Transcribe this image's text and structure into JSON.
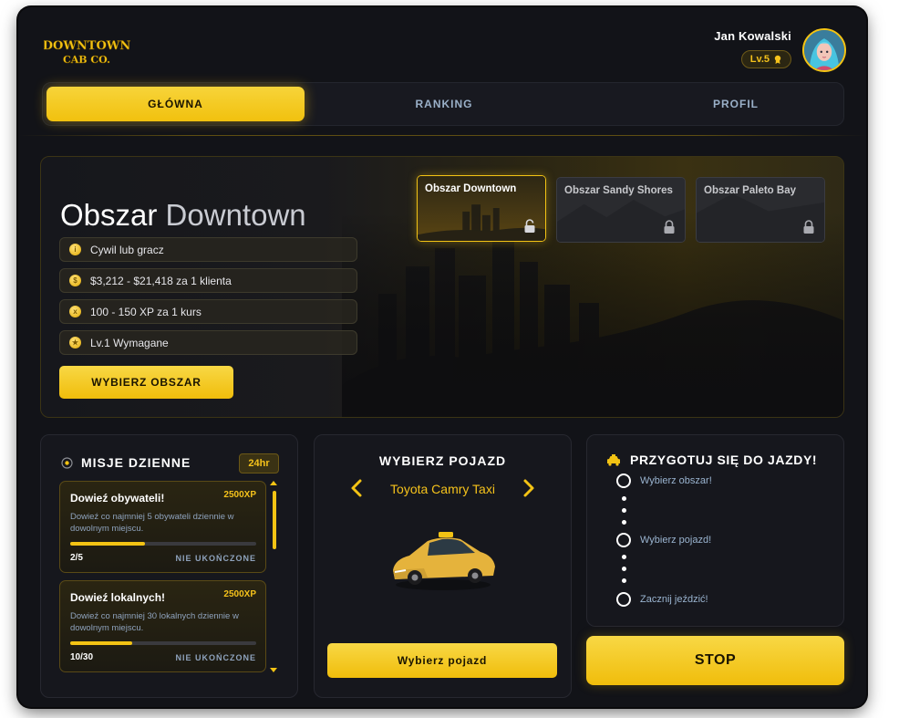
{
  "header": {
    "logo_text_line1": "DOWNTOWN",
    "logo_text_line2": "CAB CO.",
    "user_name": "Jan Kowalski",
    "level": "Lv.5"
  },
  "tabs": [
    {
      "label": "GŁÓWNA",
      "active": true
    },
    {
      "label": "RANKING",
      "active": false
    },
    {
      "label": "PROFIL",
      "active": false
    }
  ],
  "area": {
    "title_prefix": "Obszar",
    "title_name": "Downtown",
    "info": [
      {
        "icon": "info-coin-icon",
        "text": "Cywil lub gracz"
      },
      {
        "icon": "money-coin-icon",
        "text": "$3,212 - $21,418 za 1 klienta"
      },
      {
        "icon": "xp-coin-icon",
        "text": "100 - 150 XP za 1 kurs"
      },
      {
        "icon": "level-coin-icon",
        "text": "Lv.1 Wymagane"
      }
    ],
    "select_button": "WYBIERZ OBSZAR",
    "cards": [
      {
        "label": "Obszar Downtown",
        "active": true
      },
      {
        "label": "Obszar Sandy Shores",
        "active": false
      },
      {
        "label": "Obszar Paleto Bay",
        "active": false
      }
    ]
  },
  "missions": {
    "title": "MISJE DZIENNE",
    "badge": "24hr",
    "items": [
      {
        "title": "Dowieź obywateli!",
        "xp": "2500XP",
        "desc": "Dowieź co najmniej 5 obywateli dziennie w dowolnym miejscu.",
        "progress": "2/5",
        "fraction": 0.4,
        "status": "NIE UKOŃCZONE"
      },
      {
        "title": "Dowieź lokalnych!",
        "xp": "2500XP",
        "desc": "Dowieź co najmniej 30 lokalnych dziennie w dowolnym miejscu.",
        "progress": "10/30",
        "fraction": 0.333,
        "status": "NIE UKOŃCZONE"
      }
    ]
  },
  "vehicle": {
    "title": "WYBIERZ POJAZD",
    "name": "Toyota Camry Taxi",
    "button": "Wybierz pojazd"
  },
  "ready": {
    "title": "PRZYGOTUJ SIĘ DO JAZDY!",
    "steps": [
      "Wybierz obszar!",
      "Wybierz pojazd!",
      "Zacznij jeździć!"
    ]
  },
  "stop_button": "STOP",
  "colors": {
    "accent": "#f3c314",
    "background": "#121318",
    "panel": "#16171d",
    "muted_text": "#8fa3bd"
  }
}
